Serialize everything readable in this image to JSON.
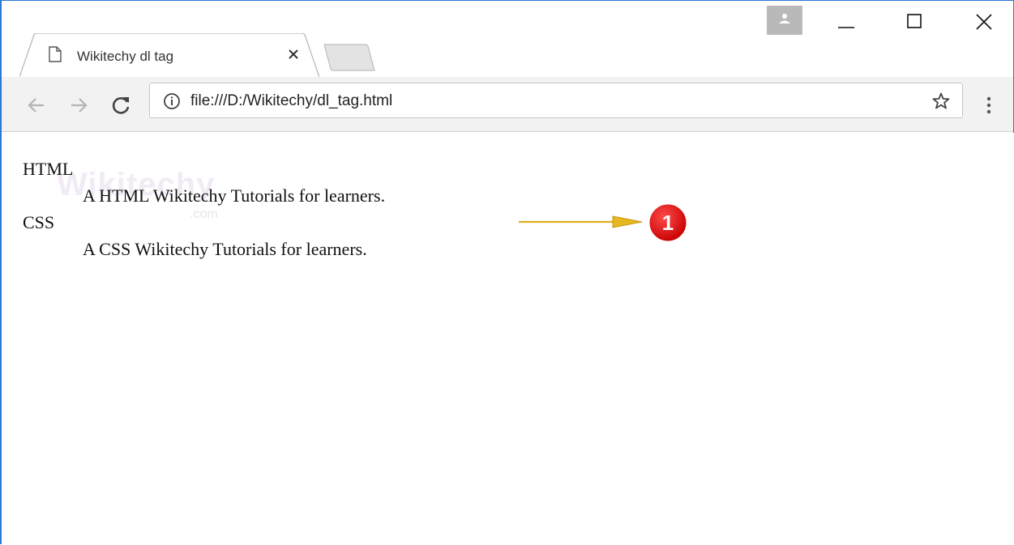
{
  "browser": {
    "tab": {
      "title": "Wikitechy dl tag",
      "close_glyph": "×",
      "icon": "page-icon"
    },
    "address_bar": {
      "url": "file:///D:/Wikitechy/dl_tag.html",
      "info_icon": "info-icon",
      "bookmark_icon": "star-icon"
    },
    "window_controls": [
      "minimize-icon",
      "maximize-icon",
      "close-icon"
    ],
    "nav_buttons": [
      "back-icon",
      "forward-icon",
      "reload-icon"
    ],
    "menu_icon": "three-dots-vertical-icon",
    "profile_icon": "person-icon"
  },
  "page": {
    "definition_list": [
      {
        "term": "HTML",
        "description": "A HTML Wikitechy Tutorials for learners."
      },
      {
        "term": "CSS",
        "description": "A CSS Wikitechy Tutorials for learners."
      }
    ],
    "watermark": {
      "text": "Wikitechy",
      "sub": ".com"
    }
  },
  "annotation": {
    "badge_number": "1",
    "badge_color": "#e00000",
    "arrow_color": "#e0b020"
  },
  "colors": {
    "window_border": "#2b79d0",
    "toolbar_bg": "#f2f2f2"
  }
}
